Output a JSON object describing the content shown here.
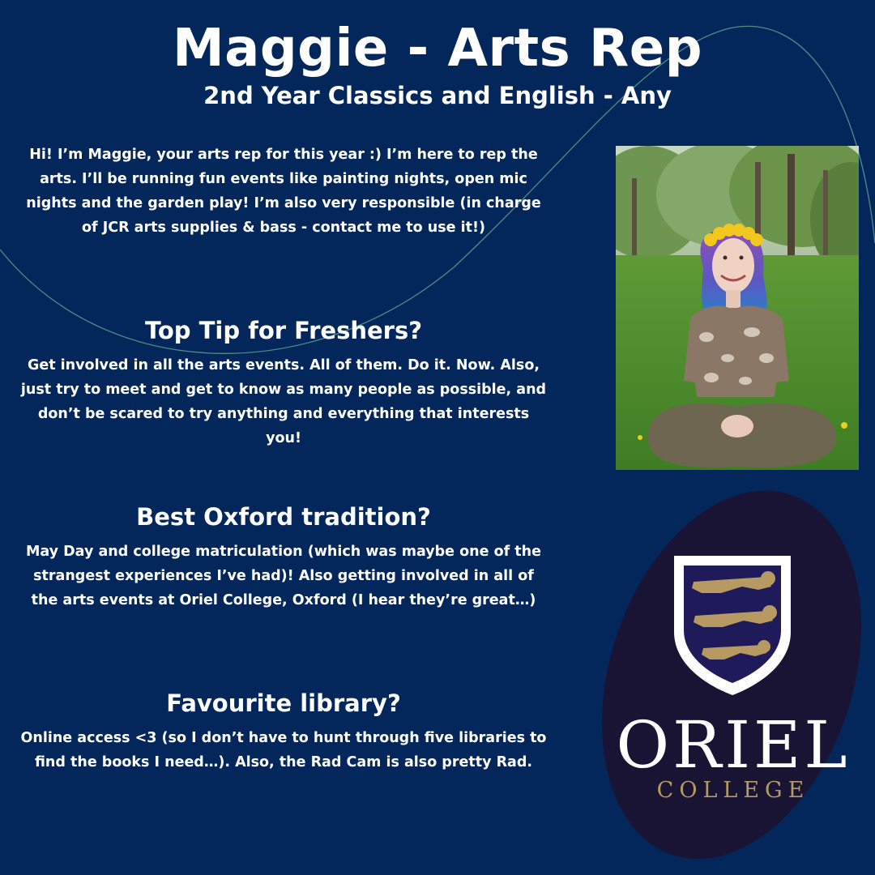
{
  "header": {
    "title": "Maggie - Arts Rep",
    "subtitle": "2nd Year Classics and English - Any"
  },
  "intro": {
    "text": "Hi! I’m Maggie, your arts rep for this year :) I’m here to rep the arts. I’ll be running fun events  like painting nights, open mic nights and the garden play! I’m also very responsible (in charge of JCR arts supplies & bass - contact me to use it!)"
  },
  "sections": [
    {
      "heading": "Top Tip for Freshers?",
      "body": "Get involved in all the arts events. All of them. Do it. Now. Also, just try to meet and get to know as many people as possible, and don’t be scared to try anything and everything that interests you!"
    },
    {
      "heading": "Best Oxford tradition?",
      "body": "May Day and college matriculation (which was maybe one of the strangest experiences I’ve had)! Also getting involved in all of the arts events at Oriel College, Oxford (I hear they’re great…)"
    },
    {
      "heading": "Favourite library?",
      "body": "Online access <3 (so I don’t have to hunt through five libraries to find the books I need…). Also, the Rad Cam is also pretty Rad."
    }
  ],
  "logo": {
    "word": "ORIEL",
    "sub": "COLLEGE"
  },
  "colors": {
    "background": "#03275b",
    "logo_oval": "#1a1434",
    "logo_gold": "#b69a61",
    "curve": "#4f8f83"
  }
}
